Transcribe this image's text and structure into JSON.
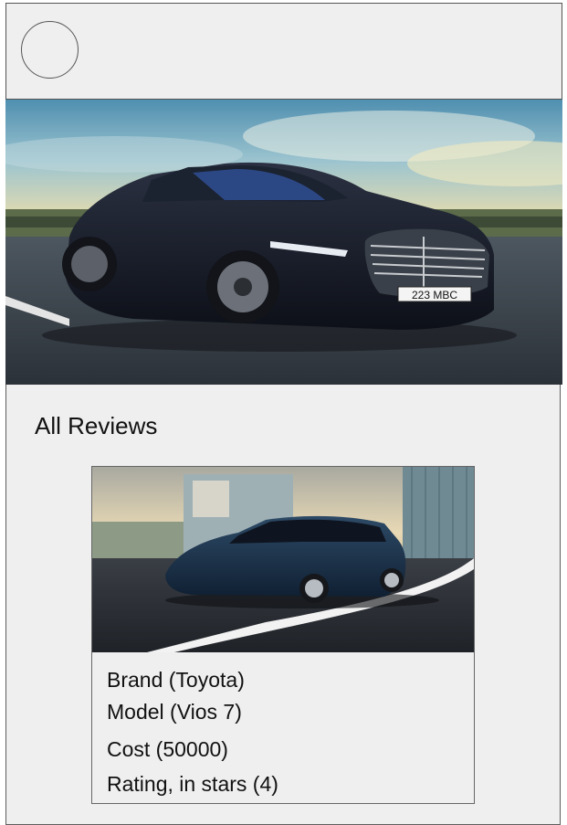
{
  "header": {
    "avatar_icon": "user-avatar-placeholder"
  },
  "hero": {
    "image": "black luxury sedan driving on road",
    "plate_text": "223 MBC"
  },
  "reviews": {
    "title": "All Reviews",
    "cards": [
      {
        "image": "dark blue hatchback car on road",
        "brand": "Brand (Toyota)",
        "model": "Model (Vios 7)",
        "cost": "Cost (50000)",
        "rating": "Rating, in stars (4)"
      }
    ]
  }
}
